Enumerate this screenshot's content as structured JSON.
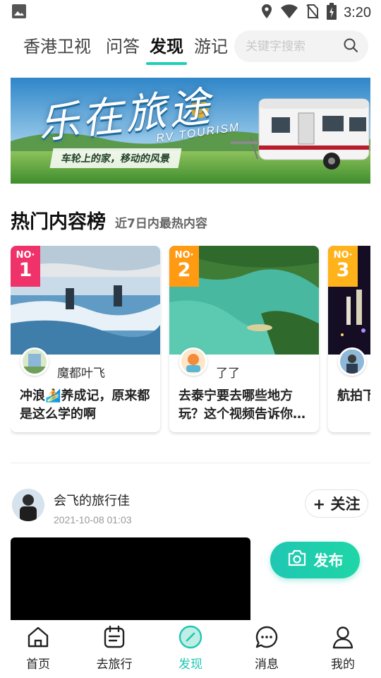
{
  "status_bar": {
    "time": "3:20",
    "icons": [
      "image-icon",
      "location-icon",
      "wifi-icon",
      "no-sim-icon",
      "battery-charging-icon"
    ]
  },
  "top_tabs": [
    {
      "label": "香港卫视",
      "active": false
    },
    {
      "label": "问答",
      "active": false
    },
    {
      "label": "发现",
      "active": true
    },
    {
      "label": "游记",
      "active": false
    }
  ],
  "search": {
    "placeholder": "关键字搜索"
  },
  "banner": {
    "title": "乐在旅途",
    "subtitle_en": "RV TOURISM",
    "slogan": "车轮上的家，移动的风景"
  },
  "hot_list": {
    "title": "热门内容榜",
    "subtitle": "近7日内最热内容",
    "items": [
      {
        "rank_prefix": "NO·",
        "rank": "1",
        "author": "魔都叶飞",
        "title": "冲浪🏄养成记，原来都是这么学的啊",
        "badge_color": "#f0326a"
      },
      {
        "rank_prefix": "NO·",
        "rank": "2",
        "author": "了了",
        "title": "去泰宁要去哪些地方玩？这个视频告诉你…",
        "badge_color": "#ff9a12"
      },
      {
        "rank_prefix": "NO·",
        "rank": "3",
        "author": "",
        "title": "航拍下",
        "badge_color": "#ffb21a"
      }
    ]
  },
  "post": {
    "author": "会飞的旅行佳",
    "time": "2021-10-08 01:03",
    "follow_label": "+ 关注"
  },
  "publish": {
    "label": "发布"
  },
  "bottom_nav": [
    {
      "label": "首页",
      "icon": "home-icon",
      "active": false
    },
    {
      "label": "去旅行",
      "icon": "calendar-icon",
      "active": false
    },
    {
      "label": "发现",
      "icon": "compass-icon",
      "active": true
    },
    {
      "label": "消息",
      "icon": "message-icon",
      "active": false
    },
    {
      "label": "我的",
      "icon": "user-icon",
      "active": false
    }
  ],
  "colors": {
    "accent": "#1fc7b3",
    "rank1": "#f0326a",
    "rank2": "#ff9a12"
  }
}
